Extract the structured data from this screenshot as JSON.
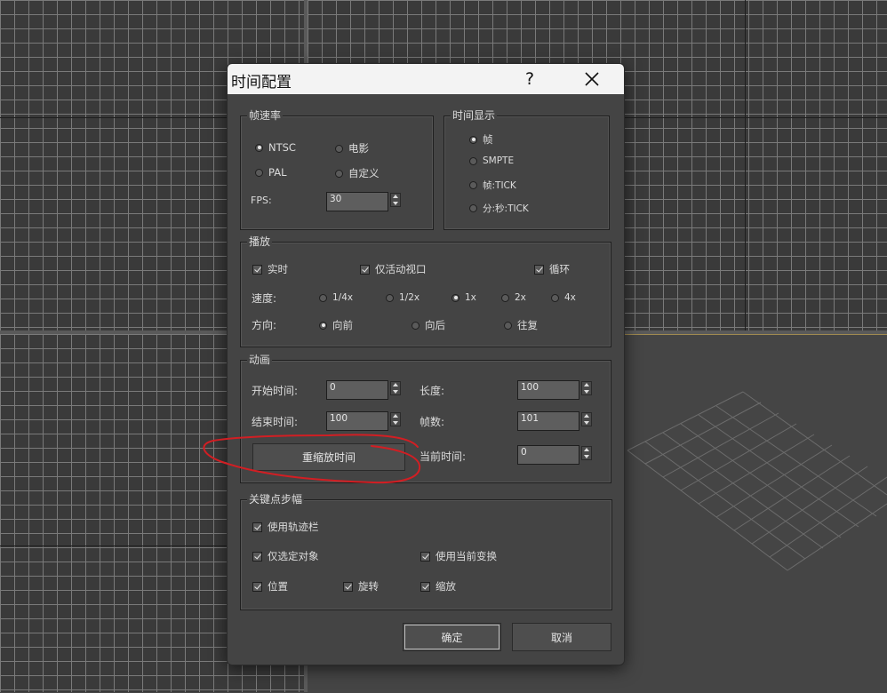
{
  "dialog": {
    "title": "时间配置",
    "help": "?",
    "close": "✕"
  },
  "frame_rate": {
    "label": "帧速率",
    "options": [
      "NTSC",
      "电影",
      "PAL",
      "自定义"
    ],
    "selected": "NTSC",
    "fps_label": "FPS:",
    "fps_value": "30"
  },
  "time_display": {
    "label": "时间显示",
    "options": [
      "帧",
      "SMPTE",
      "帧:TICK",
      "分:秒:TICK"
    ],
    "selected": "帧"
  },
  "playback": {
    "label": "播放",
    "realtime": "实时",
    "active_viewport": "仅活动视口",
    "loop": "循环",
    "speed_label": "速度:",
    "speeds": [
      "1/4x",
      "1/2x",
      "1x",
      "2x",
      "4x"
    ],
    "speed_selected": "1x",
    "direction_label": "方向:",
    "directions": [
      "向前",
      "向后",
      "往复"
    ],
    "direction_selected": "向前"
  },
  "animation": {
    "label": "动画",
    "start_label": "开始时间:",
    "start_value": "0",
    "end_label": "结束时间:",
    "end_value": "100",
    "length_label": "长度:",
    "length_value": "100",
    "frames_label": "帧数:",
    "frames_value": "101",
    "current_label": "当前时间:",
    "current_value": "0",
    "rescale_button": "重缩放时间"
  },
  "key_steps": {
    "label": "关键点步幅",
    "use_trackbar": "使用轨迹栏",
    "selected_only": "仅选定对象",
    "use_current_transform": "使用当前变换",
    "position": "位置",
    "rotation": "旋转",
    "scale": "缩放"
  },
  "footer": {
    "ok": "确定",
    "cancel": "取消"
  },
  "colors": {
    "annotation": "#d21e23",
    "dialog_bg": "#444444",
    "titlebar_bg": "#f3f3f3"
  }
}
